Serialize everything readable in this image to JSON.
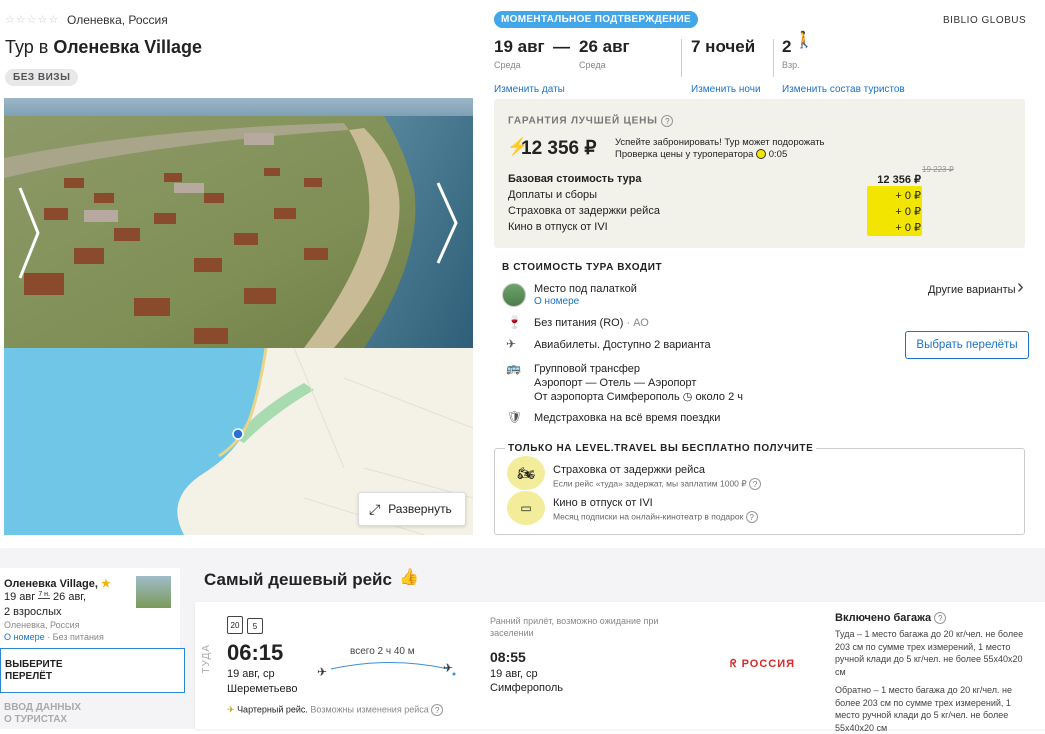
{
  "hotel": {
    "stars": "☆☆☆☆☆",
    "location": "Оленевка, Россия",
    "title_prefix": "Тур в ",
    "title_name": "Оленевка Village",
    "visa_badge": "БЕЗ ВИЗЫ",
    "expand_label": "Развернуть"
  },
  "booking": {
    "confirm_badge": "МОМЕНТАЛЬНОЕ ПОДТВЕРЖДЕНИЕ",
    "operator": "BIBLIO GLOBUS",
    "date_from": "19 авг",
    "date_dash": "—",
    "date_to": "26 авг",
    "day_from": "Среда",
    "day_to": "Среда",
    "nights": "7 ночей",
    "adults": "2",
    "adults_label": "Взр.",
    "change_dates": "Изменить даты",
    "change_nights": "Изменить ночи",
    "change_tourists": "Изменить состав туристов"
  },
  "price": {
    "guarantee": "ГАРАНТИЯ ЛУЧШЕЙ ЦЕНЫ",
    "help": "?",
    "amount": "12 356 ₽",
    "hurry_line1": "Успейте забронировать! Тур может подорожать",
    "hurry_line2": "Проверка цены у туроператора",
    "timer": "0:05",
    "old_price": "19 223 ₽",
    "rows": [
      {
        "label": "Базовая стоимость тура",
        "value": "12 356 ₽"
      },
      {
        "label": "Доплаты и сборы",
        "value": "+ 0 ₽"
      },
      {
        "label": "Страховка от задержки рейса",
        "value": "+ 0 ₽"
      },
      {
        "label": "Кино в отпуск от IVI",
        "value": "+ 0 ₽"
      }
    ]
  },
  "included": {
    "title": "В СТОИМОСТЬ ТУРА ВХОДИТ",
    "room": "Место под палаткой",
    "room_link": "О номере",
    "other_options": "Другие варианты",
    "meal": "Без питания (RO)",
    "meal_code": " · АО",
    "flights": "Авиабилеты. Доступно 2 варианта",
    "flights_btn": "Выбрать перелёты",
    "transfer_1": "Групповой трансфер",
    "transfer_2": "Аэропорт — Отель — Аэропорт",
    "transfer_3": "От аэропорта Симферополь",
    "transfer_time": "около 2 ч",
    "insurance": "Медстраховка на всё время поездки"
  },
  "bonus": {
    "title": "ТОЛЬКО НА LEVEL.TRAVEL ВЫ БЕСПЛАТНО ПОЛУЧИТЕ",
    "item1_title": "Страховка от задержки рейса",
    "item1_sub": "Если рейс «туда» задержат, мы заплатим 1000 ₽",
    "item2_title": "Кино в отпуск от IVI",
    "item2_sub": "Месяц подписки на онлайн-кинотеатр в подарок"
  },
  "sidebar": {
    "hotel_name": "Оленевка Village,",
    "date_from": "19 авг",
    "nights_short": "7 н.",
    "date_to": "26 авг,",
    "guests": "2 взрослых",
    "location": "Оленевка, Россия",
    "room_link": "О номере",
    "meal": " · Без питания",
    "step1_l1": "ВЫБЕРИТЕ",
    "step1_l2": "ПЕРЕЛЁТ",
    "step2_l1": "ВВОД ДАННЫХ",
    "step2_l2": "О ТУРИСТАХ"
  },
  "flight": {
    "section_title": "Самый дешевый рейс",
    "direction": "ТУДА",
    "icon_num1": "20",
    "icon_num2": "5",
    "dep_time": "06:15",
    "dep_date": "19 авг, ср",
    "dep_airport": "Шереметьево",
    "duration": "всего 2 ч 40 м",
    "arr_note": "Ранний прилёт, возможно ожидание при заселении",
    "arr_time": "08:55",
    "arr_date": "19 авг, ср",
    "arr_airport": "Симферополь",
    "airline": "РОССИЯ",
    "charter": "Чартерный рейс.",
    "charter_note": " Возможны изменения рейса",
    "baggage_title": "Включено багажа",
    "baggage_there": "Туда – 1 место багажа до 20 кг/чел. не более 203 см по сумме трех измерений, 1 место ручной клади до 5 кг/чел. не более 55х40х20 см",
    "baggage_back": "Обратно – 1 место багажа до 20 кг/чел. не более 203 см по сумме трех измерений, 1 место ручной клади до 5 кг/чел. не более 55х40х20 см"
  },
  "colors": {
    "accent": "#1a73c9",
    "badge": "#43a6e8",
    "price_bg": "#f3f2ea",
    "highlight": "#f2e600"
  }
}
